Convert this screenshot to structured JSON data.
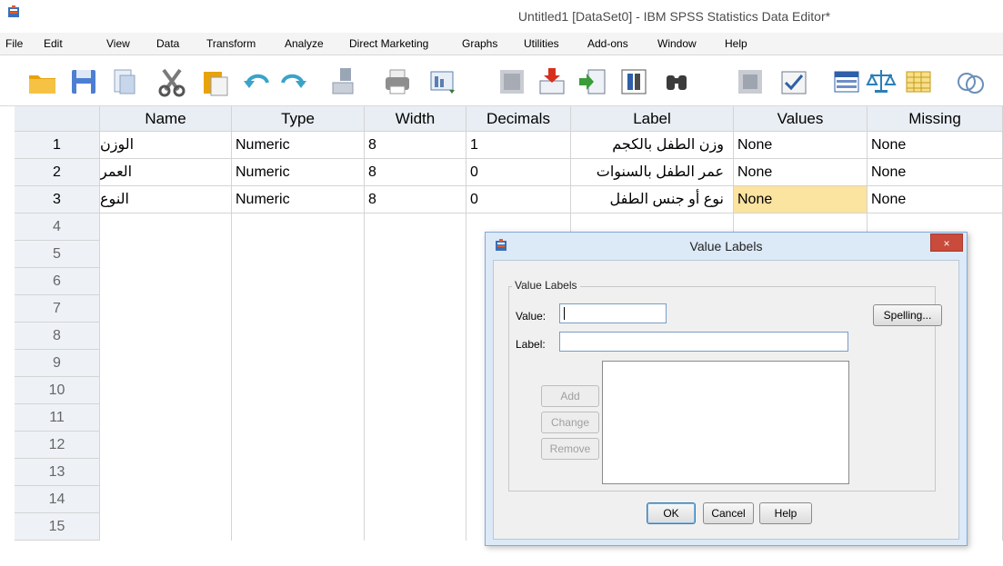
{
  "window": {
    "title": "Untitled1 [DataSet0] - IBM SPSS Statistics Data Editor*"
  },
  "menu": {
    "items": [
      "File",
      "Edit",
      "View",
      "Data",
      "Transform",
      "Analyze",
      "Direct Marketing",
      "Graphs",
      "Utilities",
      "Add-ons",
      "Window",
      "Help"
    ]
  },
  "toolbar": {
    "icons": [
      "open-icon",
      "save-icon",
      "print-preview-icon",
      "cut-icon",
      "paste-icon",
      "undo-icon",
      "redo-icon",
      "goto-case-icon",
      "print-icon",
      "dialog-recall-icon",
      "goto-data-icon",
      "insert-cases-icon",
      "insert-variable-icon",
      "split-file-icon",
      "find-icon",
      "variables-icon",
      "select-cases-icon",
      "value-labels-icon",
      "weight-icon",
      "use-sets-icon",
      "spell-icon"
    ]
  },
  "grid": {
    "columns": [
      "Name",
      "Type",
      "Width",
      "Decimals",
      "Label",
      "Values",
      "Missing"
    ],
    "rows": [
      {
        "num": "1",
        "name": "الوزن",
        "type": "Numeric",
        "width": "8",
        "decimals": "1",
        "label": "وزن الطفل بالكجم",
        "values": "None",
        "missing": "None"
      },
      {
        "num": "2",
        "name": "العمر",
        "type": "Numeric",
        "width": "8",
        "decimals": "0",
        "label": "عمر الطفل بالسنوات",
        "values": "None",
        "missing": "None"
      },
      {
        "num": "3",
        "name": "النوع",
        "type": "Numeric",
        "width": "8",
        "decimals": "0",
        "label": "نوع أو جنس الطفل",
        "values": "None",
        "missing": "None"
      }
    ],
    "empty_rows": [
      "4",
      "5",
      "6",
      "7",
      "8",
      "9",
      "10",
      "11",
      "12",
      "13",
      "14",
      "15"
    ]
  },
  "dialog": {
    "title": "Value Labels",
    "close": "×",
    "group_label": "Value Labels",
    "value_label": "Value:",
    "label_label": "Label:",
    "value_input": "",
    "label_input": "",
    "spelling_button": "Spelling...",
    "add_button": "Add",
    "change_button": "Change",
    "remove_button": "Remove",
    "ok_button": "OK",
    "cancel_button": "Cancel",
    "help_button": "Help"
  },
  "colors": {
    "selected_cell": "#fbe3a0",
    "header_bg": "#e9eef4",
    "dialog_bg": "#dce9f7",
    "close_button": "#c94b3b"
  }
}
